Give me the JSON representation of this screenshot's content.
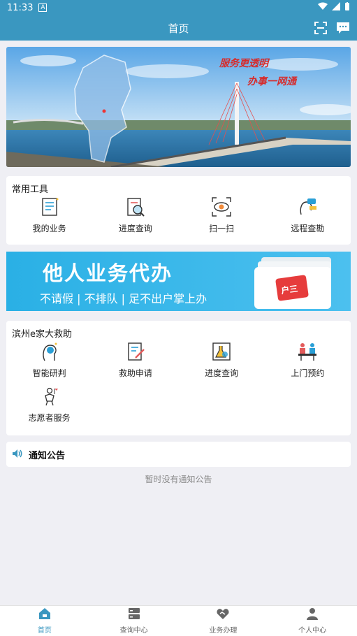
{
  "status": {
    "time": "11:33",
    "notif": "A"
  },
  "header": {
    "title": "首页"
  },
  "banner": {
    "slogan1": "服务更透明",
    "slogan2": "办事一网通"
  },
  "common_tools": {
    "title": "常用工具",
    "items": [
      {
        "label": "我的业务",
        "icon": "document-list-icon"
      },
      {
        "label": "进度查询",
        "icon": "progress-search-icon"
      },
      {
        "label": "扫一扫",
        "icon": "scan-icon"
      },
      {
        "label": "远程查勘",
        "icon": "remote-survey-icon"
      }
    ]
  },
  "promo": {
    "title": "他人业务代办",
    "subtitle": "不请假 | 不排队 | 足不出户掌上办",
    "card_text": "户三"
  },
  "aid": {
    "title": "滨州e家大救助",
    "items": [
      {
        "label": "智能研判",
        "icon": "ai-brain-icon"
      },
      {
        "label": "救助申请",
        "icon": "application-form-icon"
      },
      {
        "label": "进度查询",
        "icon": "progress-flask-icon"
      },
      {
        "label": "上门预约",
        "icon": "meeting-icon"
      },
      {
        "label": "志愿者服务",
        "icon": "volunteer-icon"
      }
    ]
  },
  "notice": {
    "title": "通知公告",
    "empty": "暂时没有通知公告"
  },
  "tabs": [
    {
      "label": "首页",
      "icon": "home-icon",
      "active": true
    },
    {
      "label": "查询中心",
      "icon": "server-icon",
      "active": false
    },
    {
      "label": "业务办理",
      "icon": "handshake-icon",
      "active": false
    },
    {
      "label": "个人中心",
      "icon": "user-icon",
      "active": false
    }
  ],
  "colors": {
    "primary": "#3a97c0",
    "promo": "#2ab0e5"
  }
}
